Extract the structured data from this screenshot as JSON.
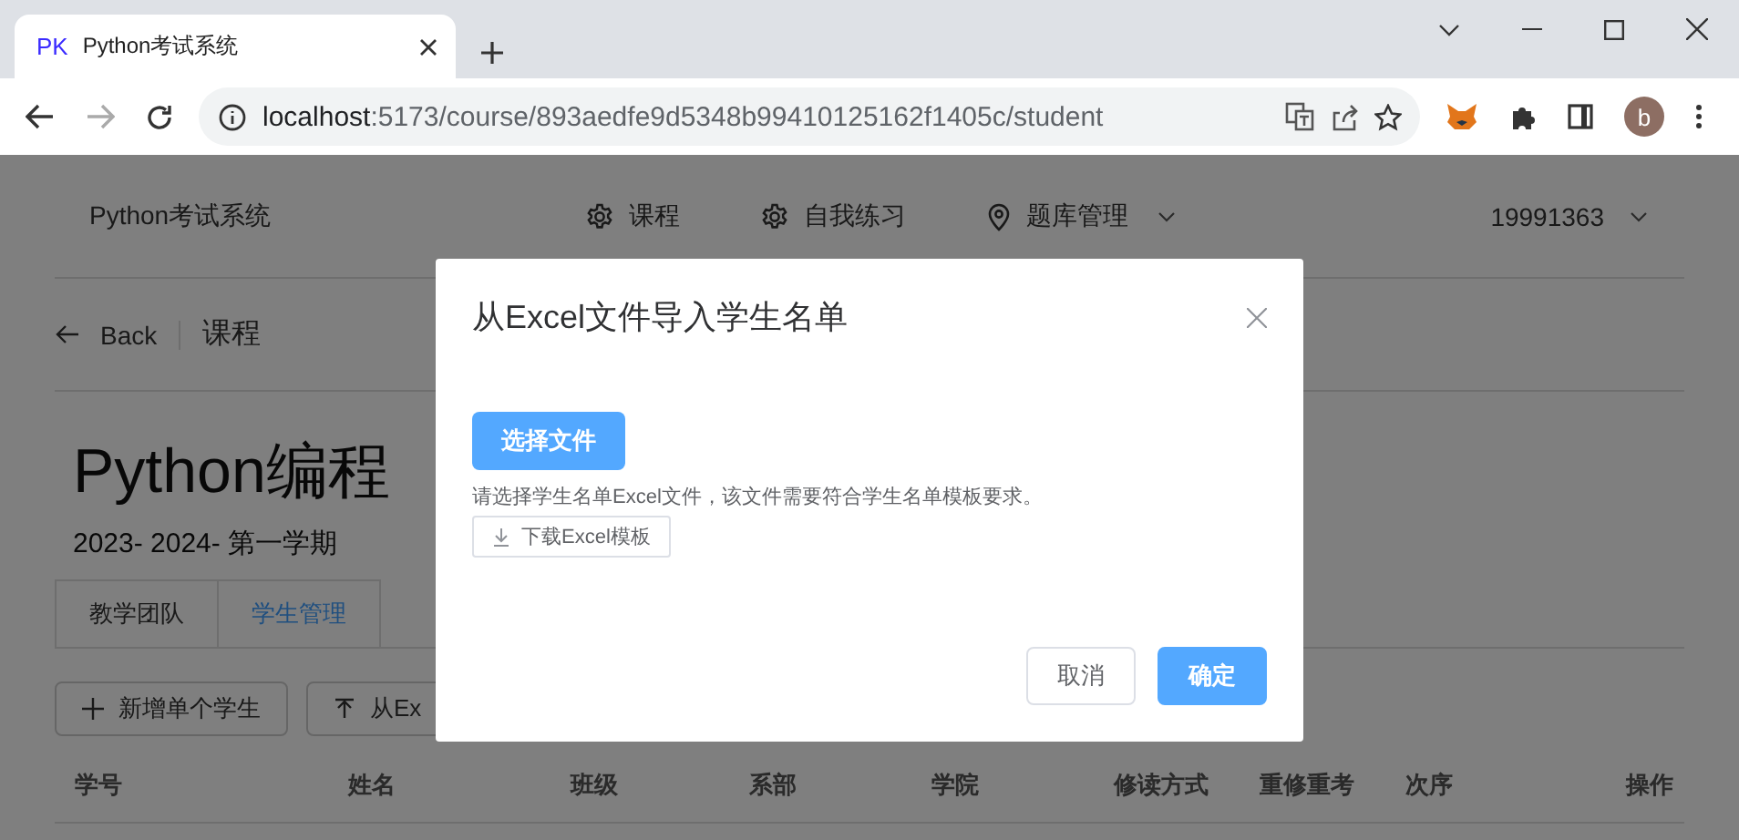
{
  "browser": {
    "tab": {
      "favicon": "PK",
      "title": "Python考试系统"
    },
    "url_host": "localhost",
    "url_path": ":5173/course/893aedfe9d5348b99410125162f1405c/student",
    "avatar": "b"
  },
  "header": {
    "brand": "Python考试系统",
    "nav": [
      {
        "label": "课程",
        "dropdown": false
      },
      {
        "label": "自我练习",
        "dropdown": false
      },
      {
        "label": "题库管理",
        "dropdown": true
      }
    ],
    "user": "19991363"
  },
  "breadcrumb": {
    "back": "Back",
    "current": "课程"
  },
  "course": {
    "title": "Python编程",
    "term": "2023- 2024- 第一学期"
  },
  "tabs": [
    {
      "label": "教学团队",
      "selected": false
    },
    {
      "label": "学生管理",
      "selected": true
    }
  ],
  "actions": [
    {
      "label": "新增单个学生"
    },
    {
      "label": "从Ex"
    }
  ],
  "table": {
    "columns": [
      "学号",
      "姓名",
      "班级",
      "系部",
      "学院",
      "修读方式",
      "重修重考",
      "次序",
      "操作"
    ]
  },
  "dialog": {
    "title": "从Excel文件导入学生名单",
    "choose_button": "选择文件",
    "hint": "请选择学生名单Excel文件，该文件需要符合学生名单模板要求。",
    "download_button": "下载Excel模板",
    "cancel_button": "取消",
    "ok_button": "确定"
  }
}
